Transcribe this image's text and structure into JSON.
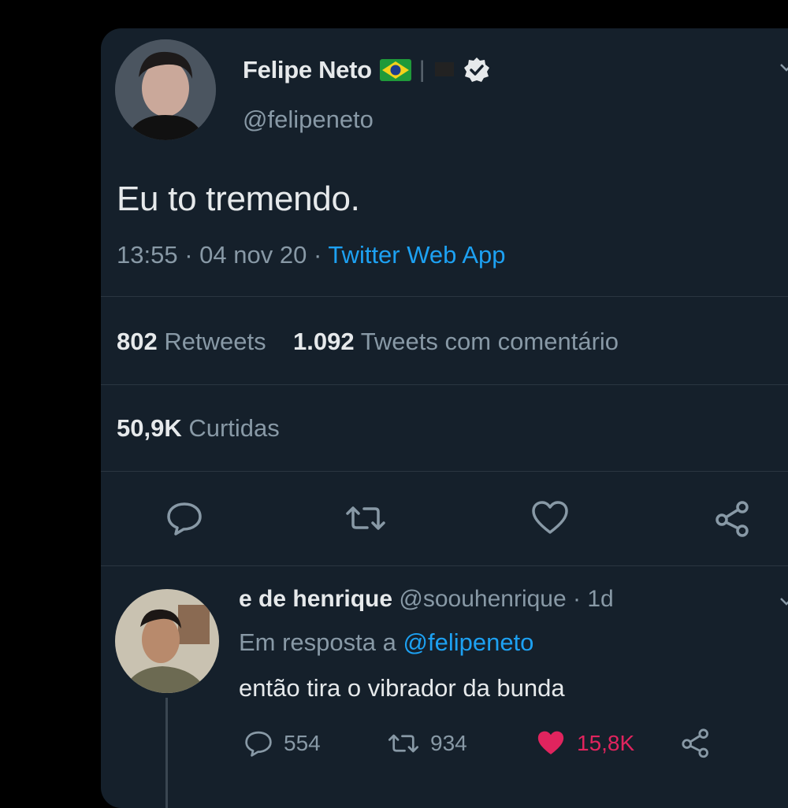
{
  "tweet": {
    "display_name": "Felipe Neto",
    "handle": "@felipeneto",
    "text": "Eu to tremendo.",
    "time": "13:55",
    "date": "04 nov 20",
    "source": "Twitter Web App",
    "retweets_count": "802",
    "retweets_label": "Retweets",
    "quotes_count": "1.092",
    "quotes_label": "Tweets com comentário",
    "likes_count": "50,9K",
    "likes_label": "Curtidas"
  },
  "reply": {
    "display_name": "e de henrique",
    "handle": "@soouhenrique",
    "age": "1d",
    "in_reply_prefix": "Em resposta a",
    "in_reply_to": "@felipeneto",
    "text": "então tira o vibrador da bunda",
    "reply_count": "554",
    "retweet_count": "934",
    "like_count": "15,8K"
  },
  "colors": {
    "background": "#000000",
    "card": "#15202b",
    "link": "#1da1f2",
    "muted": "#8899a6",
    "like": "#e0245e"
  },
  "icons": [
    "brazil-flag-icon",
    "black-flag-icon",
    "verified-badge-icon",
    "chevron-down-icon",
    "reply-icon",
    "retweet-icon",
    "heart-icon",
    "share-icon"
  ]
}
